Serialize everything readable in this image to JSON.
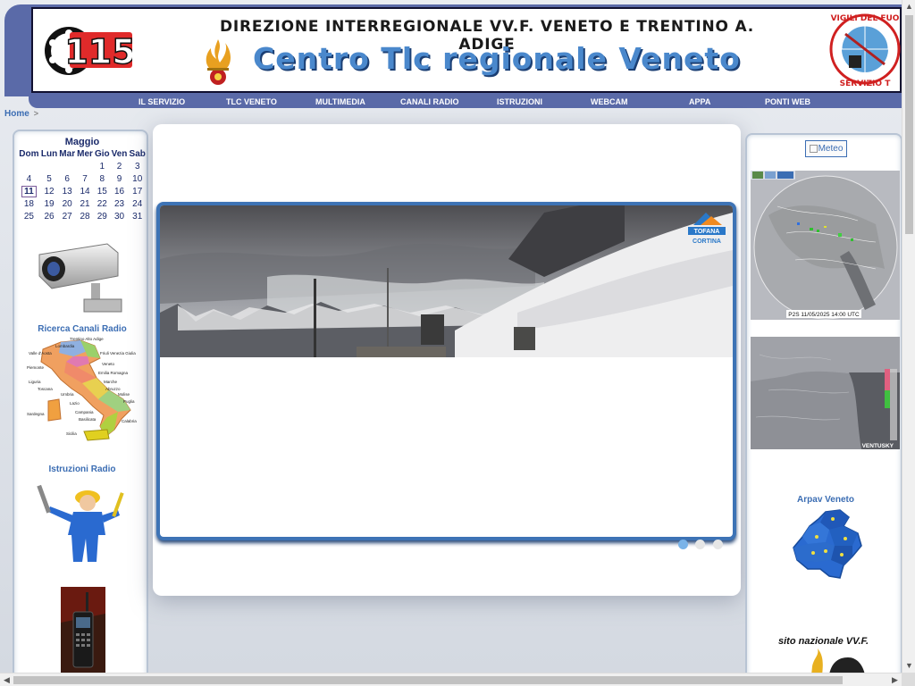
{
  "header": {
    "title": "DIREZIONE INTERREGIONALE VV.F. VENETO E TRENTINO A. ADIGE",
    "subtitle": "Centro Tlc regionale Veneto",
    "logo_115_text": "115",
    "seal_text": "VIGILI DEL FUOCO SERVIZIO TLC"
  },
  "nav": {
    "items": [
      "IL SERVIZIO",
      "TLC VENETO",
      "MULTIMEDIA",
      "CANALI RADIO",
      "ISTRUZIONI",
      "WEBCAM",
      "APPA",
      "PONTI WEB"
    ]
  },
  "breadcrumb": {
    "home": "Home",
    "separator": ">"
  },
  "calendar": {
    "month": "Maggio",
    "weekdays": [
      "Dom",
      "Lun",
      "Mar",
      "Mer",
      "Gio",
      "Ven",
      "Sab"
    ],
    "weeks": [
      [
        "",
        "",
        "",
        "",
        "1",
        "2",
        "3"
      ],
      [
        "4",
        "5",
        "6",
        "7",
        "8",
        "9",
        "10"
      ],
      [
        "11",
        "12",
        "13",
        "14",
        "15",
        "16",
        "17"
      ],
      [
        "18",
        "19",
        "20",
        "21",
        "22",
        "23",
        "24"
      ],
      [
        "25",
        "26",
        "27",
        "28",
        "29",
        "30",
        "31"
      ]
    ],
    "today": "11"
  },
  "left_links": {
    "ricerca": "Ricerca Canali Radio",
    "istruzioni": "Istruzioni Radio"
  },
  "map_regions": [
    "Trentino Alto Adige",
    "Lombardia",
    "Valle d'Aosta",
    "Friuli Venezia Giulia",
    "Veneto",
    "Piemonte",
    "Emilia Romagna",
    "Liguria",
    "Marche",
    "Toscana",
    "Abruzzo",
    "Molise",
    "Umbria",
    "Puglia",
    "Lazio",
    "Sardegna",
    "Campania",
    "Basilicata",
    "Calabria",
    "Sicilia"
  ],
  "slider": {
    "badge_line1": "TOFANA",
    "badge_line2": "CORTINA",
    "dots": 3,
    "active_dot": 0
  },
  "right_col": {
    "meteo": "Meteo",
    "radar1_caption": "P2S 11/05/2025 14:00 UTC",
    "radar2_caption": "VENTUSKY",
    "arpav": "Arpav Veneto",
    "vvf_site": "sito nazionale VV.F."
  },
  "colors": {
    "nav_bg": "#5a6aa8",
    "link": "#3b6db3",
    "slider_border": "#3d73b5"
  }
}
